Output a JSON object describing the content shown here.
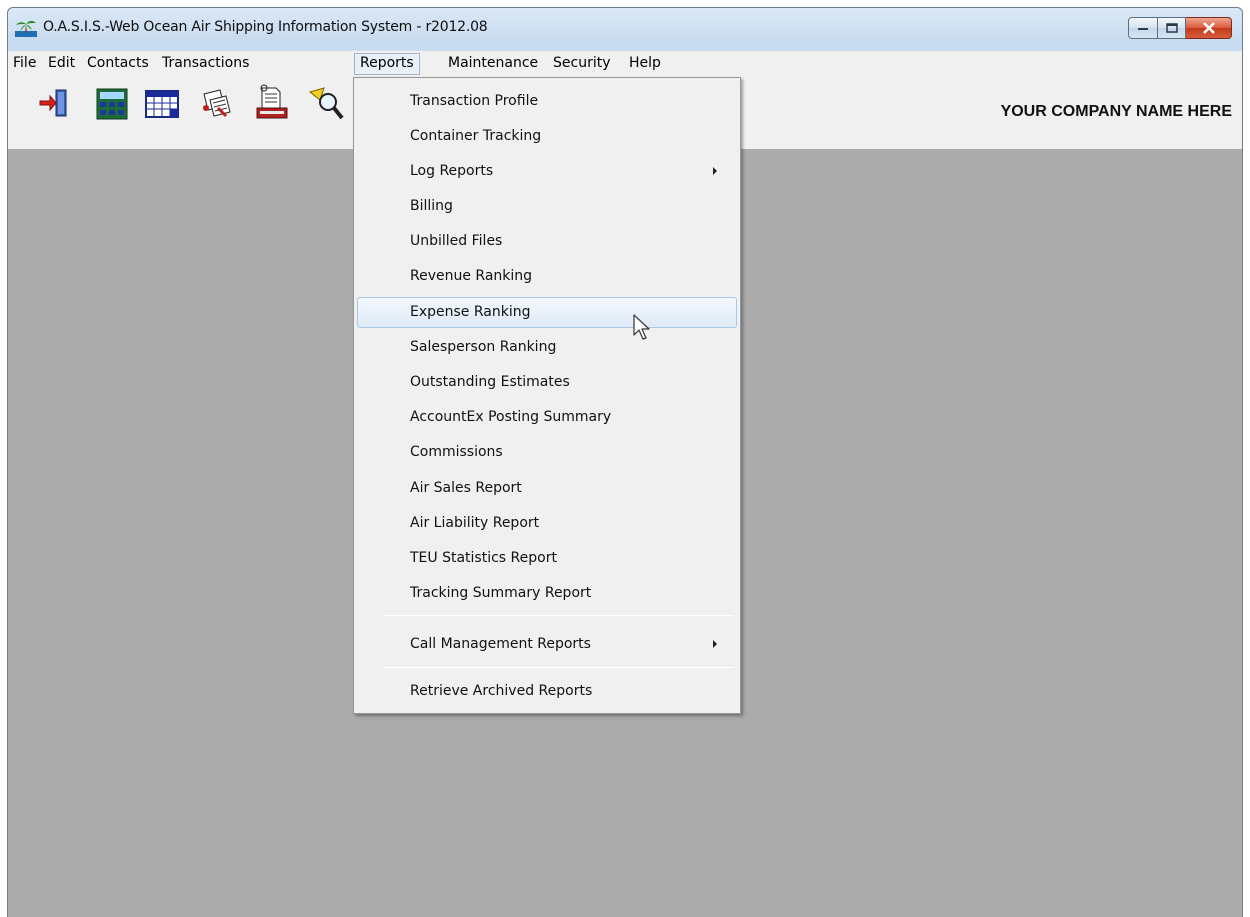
{
  "window": {
    "title": "O.A.S.I.S.-Web  Ocean Air Shipping Information System - r2012.08"
  },
  "menubar": {
    "items": [
      "File",
      "Edit",
      "Contacts",
      "Transactions",
      "Reports",
      "Maintenance",
      "Security",
      "Help"
    ],
    "active": "Reports"
  },
  "toolbar": {
    "company_name": "YOUR COMPANY NAME HERE",
    "tools": [
      "exit-icon",
      "calculator-icon",
      "calendar-icon",
      "documents-icon",
      "printer-icon",
      "search-icon"
    ]
  },
  "reports_menu": {
    "items": [
      {
        "label": "Transaction Profile",
        "submenu": false
      },
      {
        "label": "Container Tracking",
        "submenu": false
      },
      {
        "label": "Log Reports",
        "submenu": true
      },
      {
        "label": "Billing",
        "submenu": false
      },
      {
        "label": "Unbilled Files",
        "submenu": false
      },
      {
        "label": "Revenue Ranking",
        "submenu": false
      },
      {
        "label": "Expense Ranking",
        "submenu": false,
        "highlighted": true
      },
      {
        "label": "Salesperson Ranking",
        "submenu": false
      },
      {
        "label": "Outstanding Estimates",
        "submenu": false
      },
      {
        "label": "AccountEx Posting Summary",
        "submenu": false
      },
      {
        "label": "Commissions",
        "submenu": false
      },
      {
        "label": "Air Sales Report",
        "submenu": false
      },
      {
        "label": "Air Liability Report",
        "submenu": false
      },
      {
        "label": "TEU Statistics Report",
        "submenu": false
      },
      {
        "label": "Tracking Summary Report",
        "submenu": false
      },
      {
        "label": "Call Management Reports",
        "submenu": true
      },
      {
        "label": "Retrieve Archived Reports",
        "submenu": false
      }
    ]
  }
}
